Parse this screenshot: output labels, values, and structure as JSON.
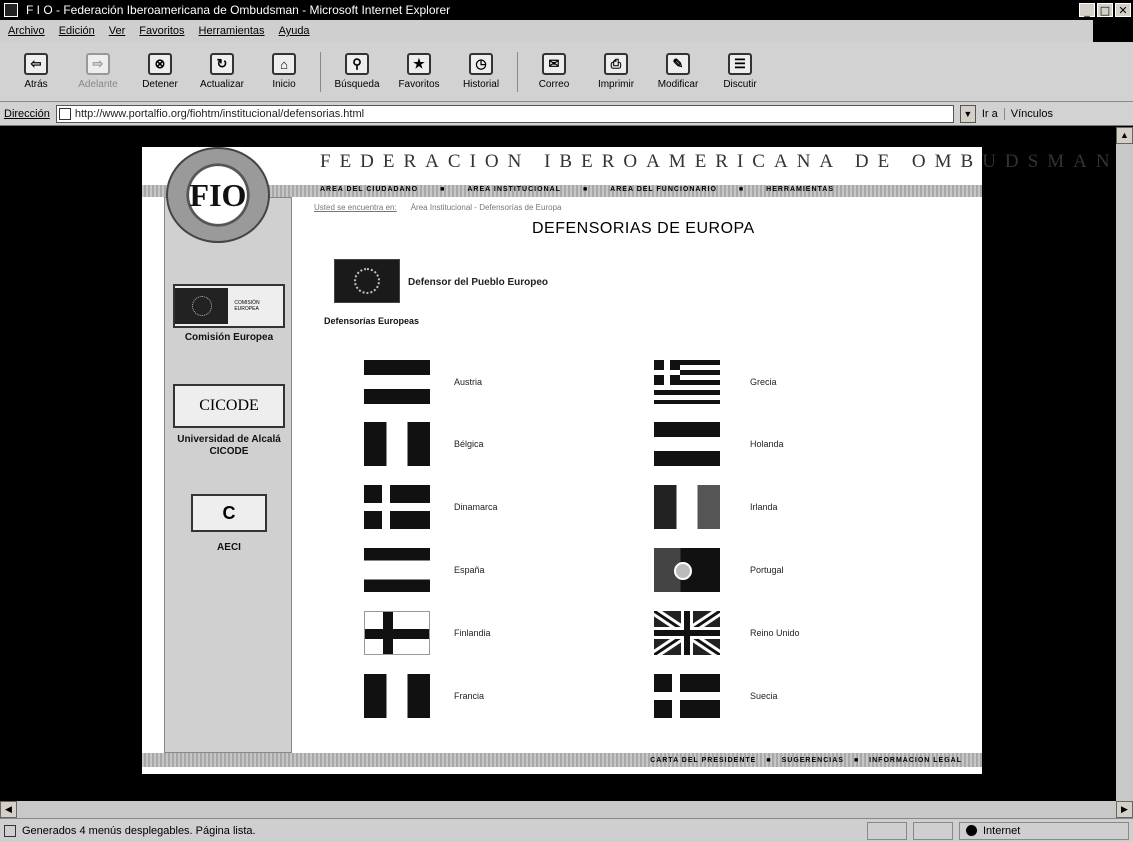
{
  "window": {
    "title": "F I O - Federación Iberoamericana de Ombudsman - Microsoft Internet Explorer",
    "controls": [
      "_",
      "□",
      "✕"
    ]
  },
  "menubar": {
    "items": [
      "Archivo",
      "Edición",
      "Ver",
      "Favoritos",
      "Herramientas",
      "Ayuda"
    ]
  },
  "toolbar": {
    "buttons": [
      {
        "label": "Atrás",
        "icon": "back-arrow-icon",
        "glyph": "⇦"
      },
      {
        "label": "Adelante",
        "icon": "forward-arrow-icon",
        "glyph": "⇨"
      },
      {
        "label": "Detener",
        "icon": "stop-icon",
        "glyph": "⊗"
      },
      {
        "label": "Actualizar",
        "icon": "refresh-icon",
        "glyph": "↻"
      },
      {
        "label": "Inicio",
        "icon": "home-icon",
        "glyph": "⌂"
      },
      {
        "label": "Búsqueda",
        "icon": "search-icon",
        "glyph": "⚲"
      },
      {
        "label": "Favoritos",
        "icon": "favorites-icon",
        "glyph": "★"
      },
      {
        "label": "Historial",
        "icon": "history-icon",
        "glyph": "◷"
      },
      {
        "label": "Correo",
        "icon": "mail-icon",
        "glyph": "✉"
      },
      {
        "label": "Imprimir",
        "icon": "print-icon",
        "glyph": "⎙"
      },
      {
        "label": "Modificar",
        "icon": "edit-icon",
        "glyph": "✎"
      },
      {
        "label": "Discutir",
        "icon": "discuss-icon",
        "glyph": "☰"
      }
    ]
  },
  "address": {
    "label": "Dirección",
    "url": "http://www.portalfio.org/fiohtm/institucional/defensorias.html",
    "go": "Ir a",
    "links": "Vínculos"
  },
  "status": {
    "text": "Generados 4 menús desplegables. Página lista.",
    "zone": "Internet"
  },
  "page": {
    "federation_title": "FEDERACION IBEROAMERICANA DE OMBUDSMAN",
    "logo_text": "FIO",
    "topnav": [
      "AREA DEL CIUDADANO",
      "AREA INSTITUCIONAL",
      "AREA DEL FUNCIONARIO",
      "HERRAMIENTAS"
    ],
    "breadcrumbs": [
      "Usted se encuentra en:",
      "Área Institucional - Defensorías de Europa"
    ],
    "section_title": "DEFENSORIAS DE EUROPA",
    "eu_ombudsman": "Defensor del Pueblo Europeo",
    "subheading": "Defensorías Europeas",
    "countries_left": [
      "Austria",
      "Bélgica",
      "Dinamarca",
      "España",
      "Finlandia",
      "Francia"
    ],
    "countries_right": [
      "Grecia",
      "Holanda",
      "Irlanda",
      "Portugal",
      "Reino Unido",
      "Suecia"
    ],
    "sidebar": {
      "box1_text": "COMISIÓN EUROPEA",
      "box1_label": "Comisión Europea",
      "box2_text": "CICODE",
      "box2_label": "Universidad de Alcalá CICODE",
      "box3_text": "C",
      "box3_label": "AECI"
    },
    "footer": [
      "CARTA DEL PRESIDENTE",
      "SUGERENCIAS",
      "INFORMACION LEGAL"
    ]
  }
}
